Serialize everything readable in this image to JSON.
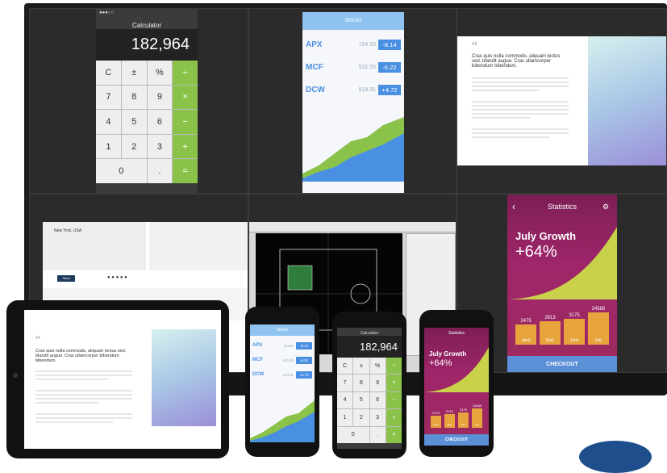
{
  "calculator": {
    "title": "Calculator",
    "display": "182,964",
    "keys": [
      "C",
      "±",
      "%",
      "÷",
      "7",
      "8",
      "9",
      "×",
      "4",
      "5",
      "6",
      "−",
      "1",
      "2",
      "3",
      "+",
      "0",
      ".",
      "="
    ]
  },
  "stocks": {
    "title": "Stocks",
    "rows": [
      {
        "ticker": "APX",
        "price": "724.55",
        "change": "-8.14"
      },
      {
        "ticker": "MCF",
        "price": "531.55",
        "change": "-6.22"
      },
      {
        "ticker": "DCW",
        "price": "814.91",
        "change": "+4.72"
      }
    ]
  },
  "quote": {
    "mark": "“",
    "text": "Cras quis nulla commodo, aliquam lectus sed, blandit augue. Cras ullamcorper bibendum bibendum."
  },
  "gallery": {
    "caption": "New York, USA",
    "button": "Send"
  },
  "statistics": {
    "title": "Statistics",
    "headline": "July Growth",
    "growth": "+64%",
    "checkout": "CHECKOUT",
    "bars": [
      {
        "label": "April",
        "value_label": "2475",
        "value": 2475
      },
      {
        "label": "May",
        "value_label": "2913",
        "value": 2913
      },
      {
        "label": "June",
        "value_label": "3175",
        "value": 3175
      },
      {
        "label": "July",
        "value_label": "24585",
        "value": 4000
      }
    ]
  },
  "colors": {
    "accent_green": "#8bc34a",
    "accent_blue": "#4a90e2",
    "stats_purple": "#9c2a5e",
    "bar_orange": "#e7a33c"
  }
}
